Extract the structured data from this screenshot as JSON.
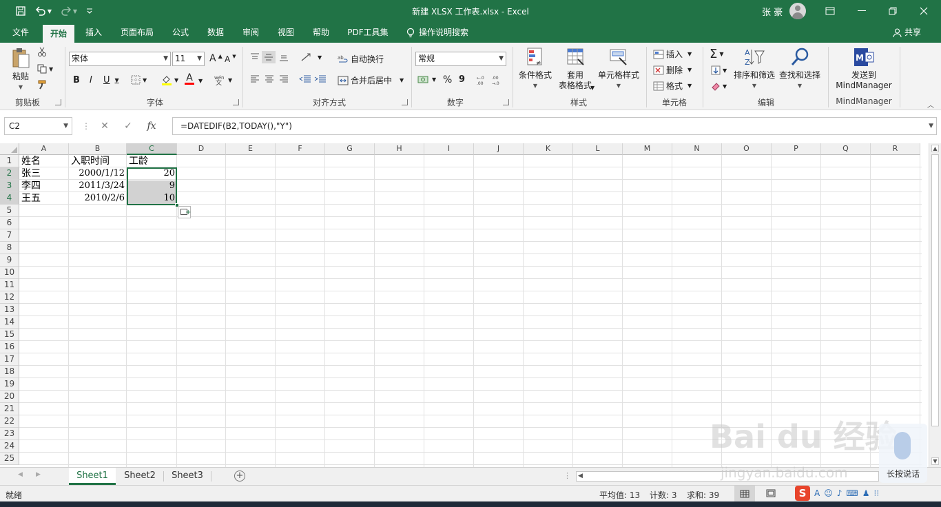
{
  "window": {
    "title": "新建 XLSX 工作表.xlsx  -  Excel",
    "user_name": "张 豪"
  },
  "menu_tabs": [
    "文件",
    "开始",
    "插入",
    "页面布局",
    "公式",
    "数据",
    "审阅",
    "视图",
    "帮助",
    "PDF工具集"
  ],
  "tell_me": "操作说明搜索",
  "share": "共享",
  "ribbon": {
    "clipboard": {
      "paste": "粘贴",
      "group": "剪贴板"
    },
    "font": {
      "name": "宋体",
      "size": "11",
      "group": "字体",
      "bold": "B",
      "italic": "I",
      "underline": "U",
      "font_color_glyph": "A",
      "grow": "A",
      "shrink": "A"
    },
    "alignment": {
      "wrap": "自动换行",
      "merge": "合并后居中",
      "group": "对齐方式"
    },
    "number": {
      "format": "常规",
      "percent": "%",
      "comma": "9",
      "group": "数字"
    },
    "styles": {
      "conditional": "条件格式",
      "table_line1": "套用",
      "table_line2": "表格格式",
      "cell_styles": "单元格样式",
      "group": "样式"
    },
    "cells": {
      "insert": "插入",
      "delete": "删除",
      "format": "格式",
      "group": "单元格"
    },
    "editing": {
      "sort": "排序和筛选",
      "find": "查找和选择",
      "group": "编辑"
    },
    "mindmanager": {
      "send_line1": "发送到",
      "send_line2": "MindManager",
      "group": "MindManager"
    }
  },
  "formula_bar": {
    "name_box": "C2",
    "fx": "fx",
    "formula": "=DATEDIF(B2,TODAY(),\"Y\")"
  },
  "grid": {
    "columns": [
      "A",
      "B",
      "C",
      "D",
      "E",
      "F",
      "G",
      "H",
      "I",
      "J",
      "K",
      "L",
      "M",
      "N",
      "O",
      "P",
      "Q",
      "R"
    ],
    "rows": [
      "1",
      "2",
      "3",
      "4",
      "5",
      "6",
      "7",
      "8",
      "9",
      "10",
      "11",
      "12",
      "13",
      "14",
      "15",
      "16",
      "17",
      "18",
      "19",
      "20",
      "21",
      "22",
      "23",
      "24",
      "25"
    ],
    "cells": {
      "A1": "姓名",
      "B1": "入职时间",
      "C1": "工龄",
      "A2": "张三",
      "B2": "2000/1/12",
      "C2": "20",
      "A3": "李四",
      "B3": "2011/3/24",
      "C3": "9",
      "A4": "王五",
      "B4": "2010/2/6",
      "C4": "10"
    }
  },
  "sheets": [
    "Sheet1",
    "Sheet2",
    "Sheet3"
  ],
  "status": {
    "mode": "就绪",
    "average": "平均值: 13",
    "count": "计数: 3",
    "sum": "求和: 39"
  },
  "overlay": {
    "voice_label": "长按说话",
    "watermark": "Bai du 经验",
    "watermark_url": "jingyan.baidu.com",
    "ime_glyph": "S"
  },
  "colors": {
    "accent": "#217346"
  }
}
